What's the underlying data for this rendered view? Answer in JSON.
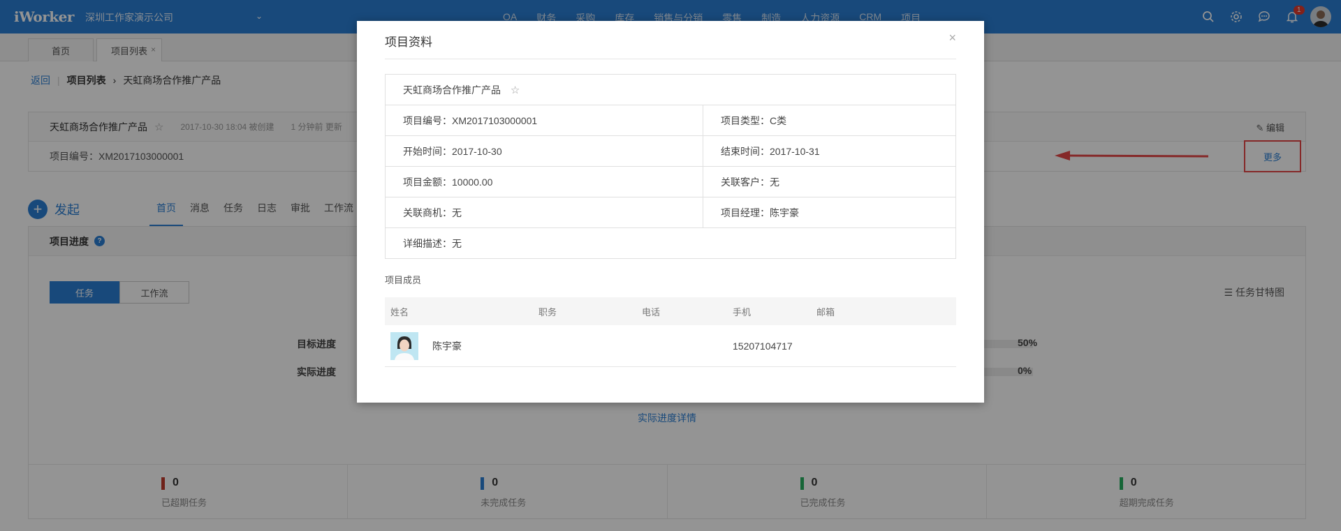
{
  "topbar": {
    "logo": "iWorker",
    "company": "深圳工作家演示公司",
    "nav": [
      "OA",
      "财务",
      "采购",
      "库存",
      "销售与分销",
      "零售",
      "制造",
      "人力资源",
      "CRM",
      "项目"
    ],
    "notification_count": "1"
  },
  "tabs": {
    "home": "首页",
    "project_list": "项目列表"
  },
  "breadcrumb": {
    "back": "返回",
    "list": "项目列表",
    "current": "天虹商场合作推广产品"
  },
  "project_card": {
    "name": "天虹商场合作推广产品",
    "created": "2017-10-30 18:04 被创建",
    "updated": "1 分钟前 更新",
    "code_line": "项目编号：XM2017103000001",
    "edit": "编辑",
    "more": "更多"
  },
  "launch": "发起",
  "subtabs": [
    "首页",
    "消息",
    "任务",
    "日志",
    "审批",
    "工作流"
  ],
  "progress": {
    "title": "项目进度",
    "seg_task": "任务",
    "seg_flow": "工作流",
    "gantt": "任务甘特图",
    "target_label": "目标进度",
    "target_value": "50%",
    "actual_label": "实际进度",
    "actual_value": "0%",
    "detail_link": "实际进度详情",
    "stats": [
      {
        "num": "0",
        "label": "已超期任务",
        "color": "#c0392b"
      },
      {
        "num": "0",
        "label": "未完成任务",
        "color": "#2a7fd4"
      },
      {
        "num": "0",
        "label": "已完成任务",
        "color": "#27ae60"
      },
      {
        "num": "0",
        "label": "超期完成任务",
        "color": "#27ae60"
      }
    ]
  },
  "modal": {
    "title": "项目资料",
    "close": "×",
    "project_name": "天虹商场合作推广产品",
    "code": "项目编号：XM2017103000001",
    "type": "项目类型：C类",
    "start": "开始时间：2017-10-30",
    "end": "结束时间：2017-10-31",
    "amount": "项目金额：10000.00",
    "customer": "关联客户：无",
    "opportunity": "关联商机：无",
    "manager": "项目经理：陈宇豪",
    "description": "详细描述：无",
    "members_title": "项目成员",
    "members_header": {
      "name": "姓名",
      "position": "职务",
      "phone": "电话",
      "mobile": "手机",
      "email": "邮箱"
    },
    "member": {
      "name": "陈宇豪",
      "position": "",
      "phone": "",
      "mobile": "15207104717",
      "email": ""
    }
  }
}
